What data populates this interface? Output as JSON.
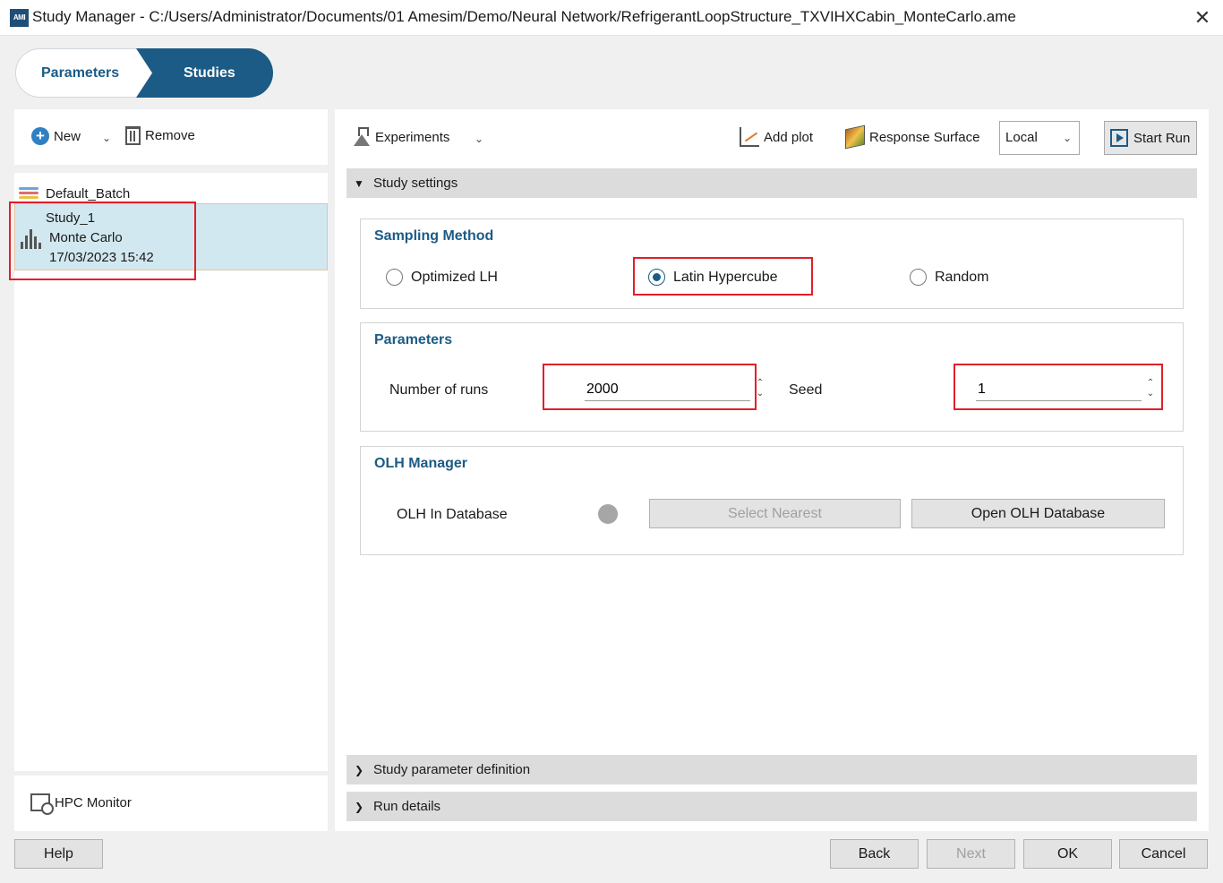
{
  "window": {
    "app_icon_text": "AMI",
    "title": "Study Manager - C:/Users/Administrator/Documents/01 Amesim/Demo/Neural Network/RefrigerantLoopStructure_TXVIHXCabin_MonteCarlo.ame",
    "close_glyph": "✕"
  },
  "mode_tabs": {
    "parameters": "Parameters",
    "studies": "Studies",
    "active": "Studies"
  },
  "left_toolbar": {
    "new_label": "New",
    "remove_label": "Remove"
  },
  "studies_list": {
    "default_batch": "Default_Batch",
    "selected_study": {
      "name": "Study_1",
      "type": "Monte Carlo",
      "date": "17/03/2023 15:42"
    }
  },
  "hpc_monitor_label": "HPC Monitor",
  "right_toolbar": {
    "experiments_label": "Experiments",
    "add_plot_label": "Add plot",
    "response_surface_label": "Response Surface",
    "run_target_value": "Local",
    "start_run_label": "Start Run"
  },
  "study_settings": {
    "header": "Study settings",
    "sampling": {
      "title": "Sampling Method",
      "options": [
        "Optimized LH",
        "Latin Hypercube",
        "Random"
      ],
      "selected": "Latin Hypercube"
    },
    "parameters": {
      "title": "Parameters",
      "runs_label": "Number of runs",
      "runs_value": "2000",
      "seed_label": "Seed",
      "seed_value": "1"
    },
    "olh": {
      "title": "OLH Manager",
      "in_db_label": "OLH In Database",
      "select_nearest_label": "Select Nearest",
      "open_db_label": "Open OLH Database"
    }
  },
  "collapsed_sections": [
    "Study parameter definition",
    "Run details"
  ],
  "footer": {
    "help": "Help",
    "back": "Back",
    "next": "Next",
    "ok": "OK",
    "cancel": "Cancel"
  },
  "colors": {
    "accent": "#1c5b86",
    "selection": "#d2e8f0",
    "highlight": "#e0202a"
  },
  "icons": {
    "new": "plus-circle-icon",
    "remove": "trash-icon",
    "default_batch": "chart-lines-icon",
    "study": "monte-carlo-icon",
    "experiments": "flask-icon",
    "add_plot": "plot-icon",
    "response_surface": "response-surface-icon",
    "start_run": "play-icon",
    "hpc": "hpc-monitor-icon"
  }
}
